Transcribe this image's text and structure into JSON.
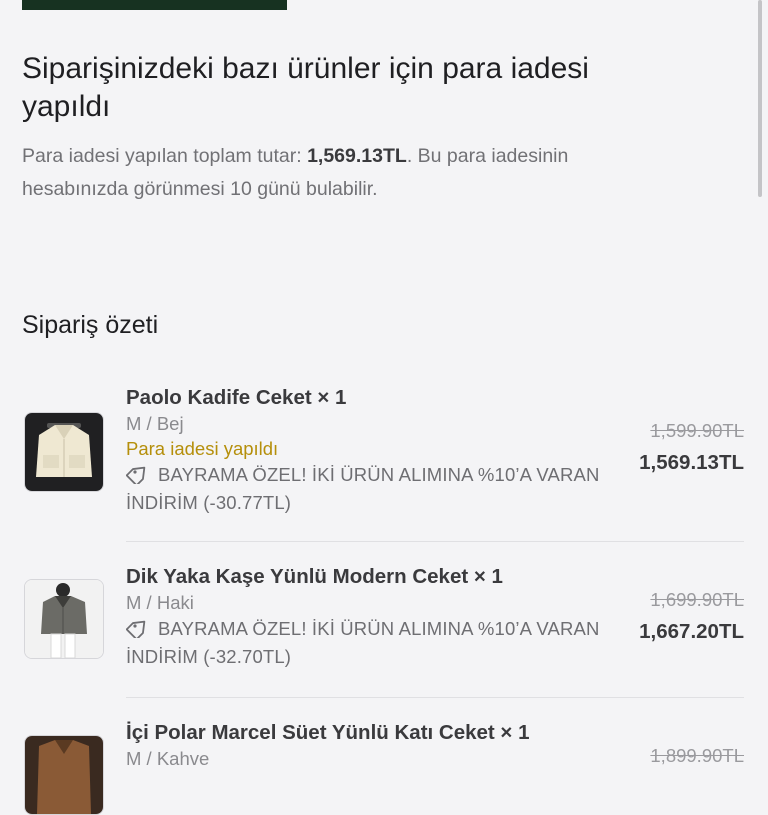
{
  "refund": {
    "title": "Siparişinizdeki bazı ürünler için para iadesi yapıldı",
    "desc_before": "Para iadesi yapılan toplam tutar: ",
    "amount": "1,569.13TL",
    "desc_after": ". Bu para iadesinin hesabınızda görünmesi 10 günü bulabilir."
  },
  "summary": {
    "title": "Sipariş özeti",
    "items": [
      {
        "name": "Paolo Kadife Ceket × 1",
        "variant": "M / Bej",
        "status": "Para iadesi yapıldı",
        "discount": "BAYRAMA ÖZEL! İKİ ÜRÜN ALIMINA %10’A VARAN İNDİRİM (-30.77TL)",
        "old_price": "1,599.90TL",
        "new_price": "1,569.13TL"
      },
      {
        "name": "Dik Yaka Kaşe Yünlü Modern Ceket × 1",
        "variant": "M / Haki",
        "discount": "BAYRAMA ÖZEL! İKİ ÜRÜN ALIMINA %10’A VARAN İNDİRİM (-32.70TL)",
        "old_price": "1,699.90TL",
        "new_price": "1,667.20TL"
      },
      {
        "name": "İçi Polar Marcel Süet Yünlü Katı Ceket × 1",
        "variant": "M / Kahve",
        "old_price": "1,899.90TL"
      }
    ]
  },
  "icons": {
    "discount": "tag-icon"
  },
  "colors": {
    "refund_status": "#b58f0b",
    "header_bar": "#173221"
  }
}
